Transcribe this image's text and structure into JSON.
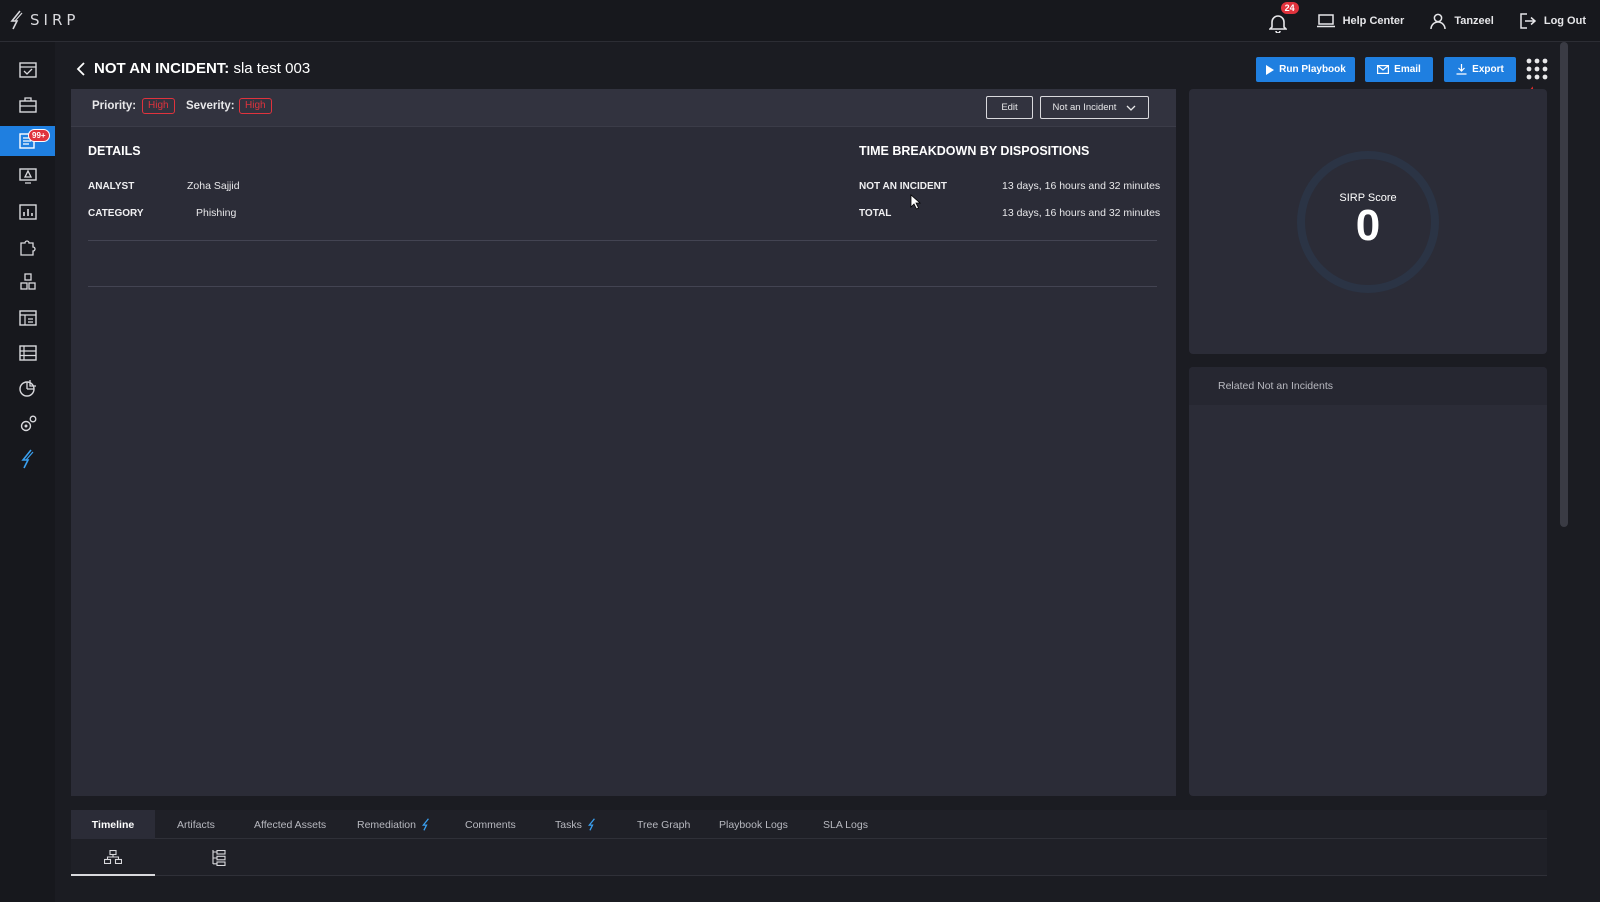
{
  "app": {
    "logo_text": "SIRP"
  },
  "topbar": {
    "notifications_count": "24",
    "help_center": "Help Center",
    "user_name": "Tanzeel",
    "logout": "Log Out"
  },
  "sidebar": {
    "active_badge": "99+",
    "items": [
      {
        "icon": "dashboard-calendar-icon"
      },
      {
        "icon": "briefcase-icon"
      },
      {
        "icon": "incidents-list-icon"
      },
      {
        "icon": "alert-monitor-icon"
      },
      {
        "icon": "analytics-chart-icon"
      },
      {
        "icon": "puzzle-icon"
      },
      {
        "icon": "cubes-icon"
      },
      {
        "icon": "reports-icon"
      },
      {
        "icon": "database-icon"
      },
      {
        "icon": "pie-chart-icon"
      },
      {
        "icon": "gears-icon"
      },
      {
        "icon": "sirp-bolt-icon"
      }
    ]
  },
  "header": {
    "title_prefix": "NOT AN INCIDENT:",
    "title_name": "sla test 003",
    "run_playbook": "Run Playbook",
    "email": "Email",
    "export": "Export"
  },
  "panel_head": {
    "priority_label": "Priority:",
    "priority_value": "High",
    "severity_label": "Severity:",
    "severity_value": "High",
    "edit": "Edit",
    "disposition": "Not an Incident"
  },
  "details": {
    "title": "DETAILS",
    "analyst_label": "ANALYST",
    "analyst_value": "Zoha Sajjid",
    "category_label": "CATEGORY",
    "category_value": "Phishing"
  },
  "time_breakdown": {
    "title": "TIME BREAKDOWN BY DISPOSITIONS",
    "rows": [
      {
        "label": "NOT AN INCIDENT",
        "value": "13 days, 16 hours and 32 minutes"
      },
      {
        "label": "TOTAL",
        "value": "13 days, 16 hours and 32 minutes"
      }
    ]
  },
  "score": {
    "label": "SIRP Score",
    "value": "0"
  },
  "related": {
    "title": "Related Not an Incidents"
  },
  "tabs": [
    {
      "label": "Timeline"
    },
    {
      "label": "Artifacts"
    },
    {
      "label": "Affected Assets"
    },
    {
      "label": "Remediation"
    },
    {
      "label": "Comments"
    },
    {
      "label": "Tasks"
    },
    {
      "label": "Tree Graph"
    },
    {
      "label": "Playbook Logs"
    },
    {
      "label": "SLA Logs"
    }
  ],
  "colors": {
    "accent": "#1f7fe0",
    "danger": "#e0333d",
    "panel": "#2b2c37",
    "background": "#1b1c22",
    "arrow_annotation": "#e02a2a"
  }
}
